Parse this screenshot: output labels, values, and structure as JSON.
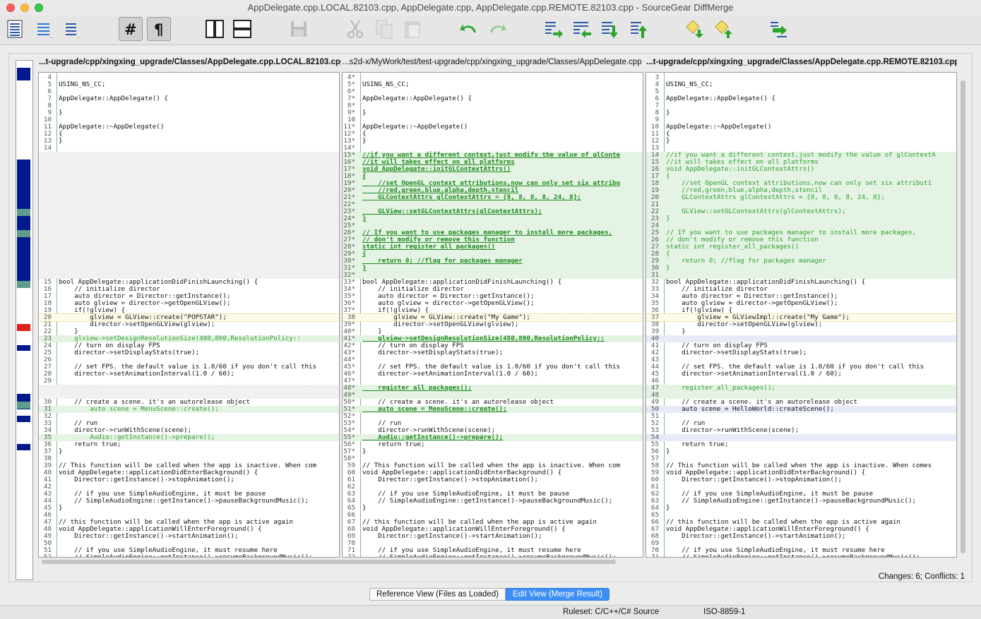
{
  "window": {
    "title": "AppDelegate.cpp.LOCAL.82103.cpp, AppDelegate.cpp, AppDelegate.cpp.REMOTE.82103.cpp - SourceGear DiffMerge"
  },
  "toolbar": {
    "buttons": [
      {
        "id": "view-full",
        "icon": "full-view-icon"
      },
      {
        "id": "view-diff-only",
        "icon": "diffs-only-icon"
      },
      {
        "id": "view-diff-context",
        "icon": "diffs-context-icon"
      },
      {
        "id": "line-numbers",
        "icon": "line-numbers-icon",
        "toggled": true
      },
      {
        "id": "show-whitespace",
        "icon": "pilcrow-icon",
        "toggled": true
      },
      {
        "id": "layout-vertical",
        "icon": "side-by-side-icon"
      },
      {
        "id": "layout-horizontal",
        "icon": "stacked-icon"
      },
      {
        "id": "save",
        "icon": "save-icon"
      },
      {
        "id": "cut",
        "icon": "cut-icon"
      },
      {
        "id": "copy",
        "icon": "copy-icon"
      },
      {
        "id": "paste",
        "icon": "paste-icon"
      },
      {
        "id": "undo",
        "icon": "undo-icon"
      },
      {
        "id": "redo",
        "icon": "redo-icon"
      },
      {
        "id": "first-change",
        "icon": "first-change-icon"
      },
      {
        "id": "prev-change",
        "icon": "prev-change-icon"
      },
      {
        "id": "next-change",
        "icon": "next-change-icon"
      },
      {
        "id": "last-change",
        "icon": "last-change-icon"
      },
      {
        "id": "next-conflict",
        "icon": "next-conflict-icon"
      },
      {
        "id": "prev-conflict",
        "icon": "prev-conflict-icon"
      },
      {
        "id": "merge",
        "icon": "auto-merge-icon"
      }
    ]
  },
  "panes": {
    "left": {
      "header": "...t-upgrade/cpp/xingxing_upgrade/Classes/AppDelegate.cpp.LOCAL.82103.cpp"
    },
    "center": {
      "header": "...s2d-x/MyWork/test/test-upgrade/cpp/xingxing_upgrade/Classes/AppDelegate.cpp"
    },
    "right": {
      "header": "...t-upgrade/cpp/xingxing_upgrade/Classes/AppDelegate.cpp.REMOTE.82103.cpp"
    }
  },
  "lines": {
    "left": [
      [
        "4",
        "",
        ""
      ],
      [
        "5",
        "USING_NS_CC;",
        ""
      ],
      [
        "6",
        "",
        ""
      ],
      [
        "7",
        "AppDelegate::AppDelegate() {",
        ""
      ],
      [
        "8",
        "",
        ""
      ],
      [
        "9",
        "}",
        ""
      ],
      [
        "10",
        "",
        ""
      ],
      [
        "11",
        "AppDelegate::~AppDelegate()",
        ""
      ],
      [
        "12",
        "{",
        ""
      ],
      [
        "13",
        "}",
        ""
      ],
      [
        "14",
        "",
        ""
      ],
      [
        "",
        "",
        "hatch"
      ],
      [
        "",
        "",
        "hatch"
      ],
      [
        "",
        "",
        "hatch"
      ],
      [
        "",
        "",
        "hatch"
      ],
      [
        "",
        "",
        "hatch"
      ],
      [
        "",
        "",
        "hatch"
      ],
      [
        "",
        "",
        "hatch"
      ],
      [
        "",
        "",
        "hatch"
      ],
      [
        "",
        "",
        "hatch"
      ],
      [
        "",
        "",
        "hatch"
      ],
      [
        "",
        "",
        "hatch"
      ],
      [
        "",
        "",
        "hatch"
      ],
      [
        "",
        "",
        "hatch"
      ],
      [
        "",
        "",
        "hatch"
      ],
      [
        "",
        "",
        "hatch"
      ],
      [
        "",
        "",
        "hatch"
      ],
      [
        "",
        "",
        "hatch"
      ],
      [
        "",
        "",
        "hatch"
      ],
      [
        "15",
        "bool AppDelegate::applicationDidFinishLaunching() {",
        ""
      ],
      [
        "16",
        "    // initialize director",
        ""
      ],
      [
        "17",
        "    auto director = Director::getInstance();",
        ""
      ],
      [
        "18",
        "    auto glview = director->getOpenGLView();",
        ""
      ],
      [
        "19",
        "    if(!glview) {",
        ""
      ],
      [
        "20",
        "        glview = GLView::create(\"POPSTAR\");",
        "yellow"
      ],
      [
        "21",
        "        director->setOpenGLView(glview);",
        ""
      ],
      [
        "22",
        "    }",
        ""
      ],
      [
        "23",
        "    glview->setDesignResolutionSize(480,800,ResolutionPolicy::",
        "green"
      ],
      [
        "24",
        "    // turn on display FPS",
        ""
      ],
      [
        "25",
        "    director->setDisplayStats(true);",
        ""
      ],
      [
        "26",
        "",
        ""
      ],
      [
        "27",
        "    // set FPS. the default value is 1.0/60 if you don't call this",
        ""
      ],
      [
        "28",
        "    director->setAnimationInterval(1.0 / 60);",
        ""
      ],
      [
        "29",
        "",
        ""
      ],
      [
        "",
        "",
        "hatch"
      ],
      [
        "",
        "",
        "hatch"
      ],
      [
        "30",
        "    // create a scene. it's an autorelease object",
        ""
      ],
      [
        "31",
        "        auto scene = MenuScene::create();",
        "greenline"
      ],
      [
        "32",
        "",
        ""
      ],
      [
        "33",
        "    // run",
        ""
      ],
      [
        "34",
        "    director->runWithScene(scene);",
        ""
      ],
      [
        "35",
        "        Audio::getInstance()->prepare();",
        "green"
      ],
      [
        "36",
        "    return true;",
        ""
      ],
      [
        "37",
        "}",
        ""
      ],
      [
        "38",
        "",
        ""
      ],
      [
        "39",
        "// This function will be called when the app is inactive. When com",
        ""
      ],
      [
        "40",
        "void AppDelegate::applicationDidEnterBackground() {",
        ""
      ],
      [
        "41",
        "    Director::getInstance()->stopAnimation();",
        ""
      ],
      [
        "42",
        "",
        ""
      ],
      [
        "43",
        "    // if you use SimpleAudioEngine, it must be pause",
        ""
      ],
      [
        "44",
        "    // SimpleAudioEngine::getInstance()->pauseBackgroundMusic();",
        ""
      ],
      [
        "45",
        "}",
        ""
      ],
      [
        "46",
        "",
        ""
      ],
      [
        "47",
        "// this function will be called when the app is active again",
        ""
      ],
      [
        "48",
        "void AppDelegate::applicationWillEnterForeground() {",
        ""
      ],
      [
        "49",
        "    Director::getInstance()->startAnimation();",
        ""
      ],
      [
        "50",
        "",
        ""
      ],
      [
        "51",
        "    // if you use SimpleAudioEngine, it must resume here",
        ""
      ],
      [
        "52",
        "    // SimpleAudioEngine::getInstance()->resumeBackgroundMusic();",
        ""
      ]
    ],
    "center": [
      [
        "4*",
        "",
        ""
      ],
      [
        "5*",
        "USING_NS_CC;",
        ""
      ],
      [
        "6*",
        "",
        ""
      ],
      [
        "7*",
        "AppDelegate::AppDelegate() {",
        ""
      ],
      [
        "8*",
        "",
        ""
      ],
      [
        "9*",
        "}",
        ""
      ],
      [
        "10",
        "",
        ""
      ],
      [
        "11*",
        "AppDelegate::~AppDelegate()",
        ""
      ],
      [
        "12*",
        "{",
        ""
      ],
      [
        "13*",
        "}",
        ""
      ],
      [
        "14*",
        "",
        ""
      ],
      [
        "15*",
        "//if you want a different context,just modify the value of glConte",
        "gbold"
      ],
      [
        "16*",
        "//it will takes effect on all platforms",
        "gbold"
      ],
      [
        "17*",
        "void AppDelegate::initGLContextAttrs()",
        "gbold"
      ],
      [
        "18*",
        "{",
        "gbold"
      ],
      [
        "19*",
        "    //set OpenGL context attributions,now can only set six attribu",
        "gbold"
      ],
      [
        "20*",
        "    //red,green,blue,alpha,depth,stencil",
        "gbold"
      ],
      [
        "21*",
        "    GLContextAttrs glContextAttrs = {8, 8, 8, 8, 24, 8};",
        "gbold"
      ],
      [
        "22*",
        "",
        "gfill"
      ],
      [
        "23*",
        "    GLView::setGLContextAttrs(glContextAttrs);",
        "gbold"
      ],
      [
        "24*",
        "}",
        "gbold"
      ],
      [
        "25*",
        "",
        "gfill"
      ],
      [
        "26*",
        "// If you want to use packages manager to install more packages,",
        "gbold"
      ],
      [
        "27*",
        "// don't modify or remove this function",
        "gbold"
      ],
      [
        "28*",
        "static int register_all_packages()",
        "gbold"
      ],
      [
        "29*",
        "{",
        "gbold"
      ],
      [
        "30*",
        "    return 0; //flag for packages manager",
        "gbold"
      ],
      [
        "31*",
        "}",
        "gbold"
      ],
      [
        "32*",
        "",
        "gfill"
      ],
      [
        "33*",
        "bool AppDelegate::applicationDidFinishLaunching() {",
        ""
      ],
      [
        "34*",
        "    // initialize director",
        ""
      ],
      [
        "35*",
        "    auto director = Director::getInstance();",
        ""
      ],
      [
        "36*",
        "    auto glview = director->getOpenGLView();",
        ""
      ],
      [
        "37*",
        "    if(!glview) {",
        ""
      ],
      [
        "38",
        "        glview = GLView::create(\"My Game\");",
        "yellow"
      ],
      [
        "39*",
        "        director->setOpenGLView(glview);",
        ""
      ],
      [
        "40*",
        "    }",
        ""
      ],
      [
        "41*",
        "    glview->setDesignResolutionSize(480,800,ResolutionPolicy::",
        "gboldfill"
      ],
      [
        "42*",
        "    // turn on display FPS",
        ""
      ],
      [
        "43*",
        "    director->setDisplayStats(true);",
        ""
      ],
      [
        "44*",
        "",
        ""
      ],
      [
        "45*",
        "    // set FPS. the default value is 1.0/60 if you don't call this",
        ""
      ],
      [
        "46*",
        "    director->setAnimationInterval(1.0 / 60);",
        ""
      ],
      [
        "47*",
        "",
        ""
      ],
      [
        "48*",
        "    register_all_packages();",
        "gboldfill"
      ],
      [
        "49*",
        "",
        "gfill"
      ],
      [
        "50*",
        "    // create a scene. it's an autorelease object",
        ""
      ],
      [
        "51*",
        "    auto scene = MenuScene::create();",
        "gbold"
      ],
      [
        "52*",
        "",
        ""
      ],
      [
        "53*",
        "    // run",
        ""
      ],
      [
        "54*",
        "    director->runWithScene(scene);",
        ""
      ],
      [
        "55*",
        "    Audio::getInstance()->prepare();",
        "gboldfill"
      ],
      [
        "56*",
        "    return true;",
        ""
      ],
      [
        "57*",
        "}",
        ""
      ],
      [
        "58*",
        "",
        ""
      ],
      [
        "59",
        "// This function will be called when the app is inactive. When com",
        ""
      ],
      [
        "60",
        "void AppDelegate::applicationDidEnterBackground() {",
        ""
      ],
      [
        "61",
        "    Director::getInstance()->stopAnimation();",
        ""
      ],
      [
        "62",
        "",
        ""
      ],
      [
        "63",
        "    // if you use SimpleAudioEngine, it must be pause",
        ""
      ],
      [
        "64",
        "    // SimpleAudioEngine::getInstance()->pauseBackgroundMusic();",
        ""
      ],
      [
        "65",
        "}",
        ""
      ],
      [
        "66",
        "",
        ""
      ],
      [
        "67",
        "// this function will be called when the app is active again",
        ""
      ],
      [
        "68",
        "void AppDelegate::applicationWillEnterForeground() {",
        ""
      ],
      [
        "69",
        "    Director::getInstance()->startAnimation();",
        ""
      ],
      [
        "70",
        "",
        ""
      ],
      [
        "71",
        "    // if you use SimpleAudioEngine, it must resume here",
        ""
      ],
      [
        "72",
        "    // SimpleAudioEngine::getInstance()->resumeBackgroundMusic();",
        ""
      ]
    ],
    "right": [
      [
        "3",
        "",
        ""
      ],
      [
        "4",
        "USING_NS_CC;",
        ""
      ],
      [
        "5",
        "",
        ""
      ],
      [
        "6",
        "AppDelegate::AppDelegate() {",
        ""
      ],
      [
        "7",
        "",
        ""
      ],
      [
        "8",
        "}",
        ""
      ],
      [
        "9",
        "",
        ""
      ],
      [
        "10",
        "AppDelegate::~AppDelegate()",
        ""
      ],
      [
        "11",
        "{",
        ""
      ],
      [
        "12",
        "}",
        ""
      ],
      [
        "13",
        "",
        ""
      ],
      [
        "14",
        "//if you want a different context,just modify the value of glContextA",
        "green"
      ],
      [
        "15",
        "//it will takes effect on all platforms",
        "green"
      ],
      [
        "16",
        "void AppDelegate::initGLContextAttrs()",
        "green"
      ],
      [
        "17",
        "{",
        "green"
      ],
      [
        "18",
        "    //set OpenGL context attributions,now can only set six attributi",
        "green"
      ],
      [
        "19",
        "    //red,green,blue,alpha,depth,stencil",
        "green"
      ],
      [
        "20",
        "    GLContextAttrs glContextAttrs = {8, 8, 8, 8, 24, 8};",
        "green"
      ],
      [
        "21",
        "",
        "green"
      ],
      [
        "22",
        "    GLView::setGLContextAttrs(glContextAttrs);",
        "green"
      ],
      [
        "23",
        "}",
        "green"
      ],
      [
        "24",
        "",
        "green"
      ],
      [
        "25",
        "// If you want to use packages manager to install more packages,",
        "green"
      ],
      [
        "26",
        "// don't modify or remove this function",
        "green"
      ],
      [
        "27",
        "static int register_all_packages()",
        "green"
      ],
      [
        "28",
        "{",
        "green"
      ],
      [
        "29",
        "    return 0; //flag for packages manager",
        "green"
      ],
      [
        "30",
        "}",
        "green"
      ],
      [
        "31",
        "",
        "green"
      ],
      [
        "32",
        "bool AppDelegate::applicationDidFinishLaunching() {",
        ""
      ],
      [
        "33",
        "    // initialize director",
        ""
      ],
      [
        "34",
        "    auto director = Director::getInstance();",
        ""
      ],
      [
        "35",
        "    auto glview = director->getOpenGLView();",
        ""
      ],
      [
        "36",
        "    if(!glview) {",
        ""
      ],
      [
        "37",
        "        glview = GLViewImpl::create(\"My Game\");",
        "yellow"
      ],
      [
        "38",
        "        director->setOpenGLView(glview);",
        ""
      ],
      [
        "39",
        "    }",
        ""
      ],
      [
        "40",
        "",
        "blue"
      ],
      [
        "41",
        "    // turn on display FPS",
        ""
      ],
      [
        "42",
        "    director->setDisplayStats(true);",
        ""
      ],
      [
        "43",
        "",
        ""
      ],
      [
        "44",
        "    // set FPS. the default value is 1.0/60 if you don't call this",
        ""
      ],
      [
        "45",
        "    director->setAnimationInterval(1.0 / 60);",
        ""
      ],
      [
        "46",
        "",
        ""
      ],
      [
        "47",
        "    register_all_packages();",
        "green"
      ],
      [
        "48",
        "",
        "green"
      ],
      [
        "49",
        "    // create a scene. it's an autorelease object",
        ""
      ],
      [
        "50",
        "    auto scene = HelloWorld::createScene();",
        "blue"
      ],
      [
        "51",
        "",
        ""
      ],
      [
        "52",
        "    // run",
        ""
      ],
      [
        "53",
        "    director->runWithScene(scene);",
        ""
      ],
      [
        "54",
        "",
        "blue"
      ],
      [
        "55",
        "    return true;",
        ""
      ],
      [
        "56",
        "}",
        ""
      ],
      [
        "57",
        "",
        ""
      ],
      [
        "58",
        "// This function will be called when the app is inactive. When comes",
        ""
      ],
      [
        "59",
        "void AppDelegate::applicationDidEnterBackground() {",
        ""
      ],
      [
        "60",
        "    Director::getInstance()->stopAnimation();",
        ""
      ],
      [
        "61",
        "",
        ""
      ],
      [
        "62",
        "    // if you use SimpleAudioEngine, it must be pause",
        ""
      ],
      [
        "63",
        "    // SimpleAudioEngine::getInstance()->pauseBackgroundMusic();",
        ""
      ],
      [
        "64",
        "}",
        ""
      ],
      [
        "65",
        "",
        ""
      ],
      [
        "66",
        "// this function will be called when the app is active again",
        ""
      ],
      [
        "67",
        "void AppDelegate::applicationWillEnterForeground() {",
        ""
      ],
      [
        "68",
        "    Director::getInstance()->startAnimation();",
        ""
      ],
      [
        "69",
        "",
        ""
      ],
      [
        "70",
        "    // if you use SimpleAudioEngine, it must resume here",
        ""
      ],
      [
        "71",
        "    // SimpleAudioEngine::getInstance()->resumeBackgroundMusic();",
        ""
      ]
    ]
  },
  "status": {
    "changes": "Changes: 6; Conflicts: 1",
    "ruleset": "Ruleset: C/C++/C# Source",
    "encoding": "ISO-8859-1"
  },
  "viewbar": {
    "reference_label": "Reference View (Files as Loaded)",
    "edit_label": "Edit View (Merge Result)"
  },
  "colors": {
    "accent": "#3d8ef5",
    "change_blue": "#001a8c",
    "conflict_red": "#e0201c",
    "insert_green": "#e4f3e4"
  }
}
